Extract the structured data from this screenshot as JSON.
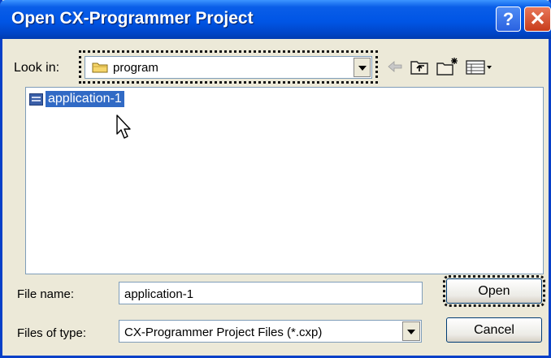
{
  "window": {
    "title": "Open CX-Programmer Project"
  },
  "titlebar": {
    "help_glyph": "?",
    "close_glyph": "✕"
  },
  "lookin": {
    "label": "Look in:",
    "value": "program",
    "icon": "folder-icon"
  },
  "toolbar": {
    "icons": [
      "back-arrow-icon",
      "up-folder-icon",
      "new-folder-icon",
      "views-menu-icon"
    ]
  },
  "filelist": {
    "items": [
      {
        "name": "application-1",
        "selected": true,
        "icon": "project-file-icon"
      }
    ]
  },
  "filename": {
    "label": "File name:",
    "value": "application-1"
  },
  "filetype": {
    "label": "Files of type:",
    "value": "CX-Programmer Project Files (*.cxp)"
  },
  "buttons": {
    "open": "Open",
    "cancel": "Cancel"
  },
  "colors": {
    "titlebar": "#0055e5",
    "selection": "#316ac5",
    "dialog_bg": "#ece9d8"
  }
}
